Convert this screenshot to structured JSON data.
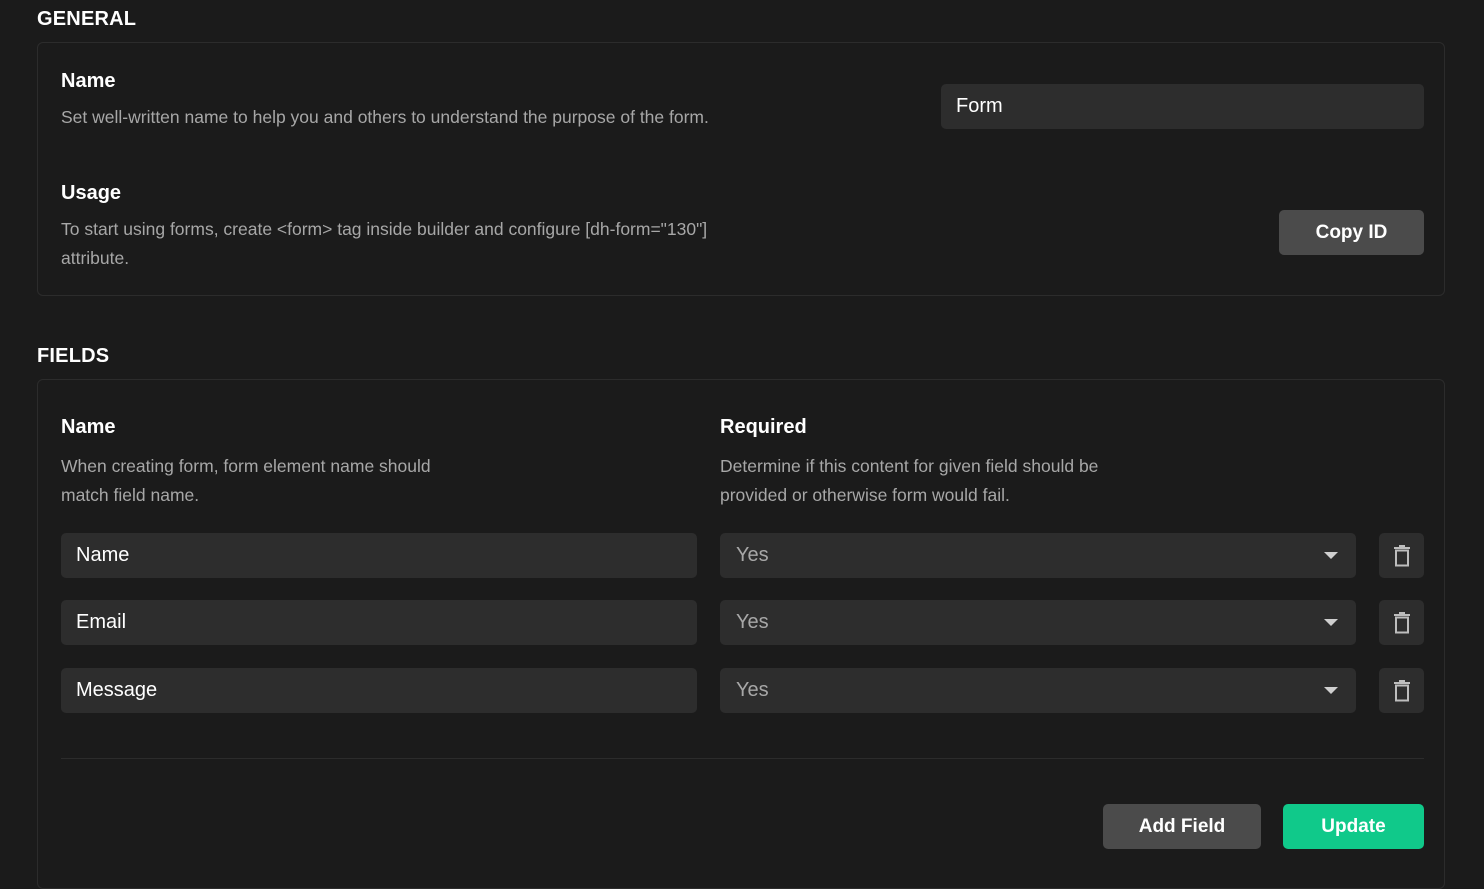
{
  "general": {
    "title": "GENERAL",
    "name_label": "Name",
    "name_description": "Set well-written name to help you and others to understand the purpose of the form.",
    "name_value": "Form",
    "usage_label": "Usage",
    "usage_description_line1": "To start using forms, create <form> tag inside builder and configure [dh-form=\"130\"]",
    "usage_description_line2": "attribute.",
    "copy_id_label": "Copy ID"
  },
  "fields": {
    "title": "FIELDS",
    "name_header": "Name",
    "name_description_line1": "When creating form, form element name should",
    "name_description_line2": "match field name.",
    "required_header": "Required",
    "required_description_line1": "Determine if this content for given field should be",
    "required_description_line2": "provided or otherwise form would fail.",
    "rows": [
      {
        "name": "Name",
        "required": "Yes"
      },
      {
        "name": "Email",
        "required": "Yes"
      },
      {
        "name": "Message",
        "required": "Yes"
      }
    ],
    "add_field_label": "Add Field",
    "update_label": "Update"
  },
  "colors": {
    "background": "#1b1b1b",
    "input_bg": "#2d2d2d",
    "accent_green": "#10c98a",
    "secondary_button": "#4b4b4b"
  },
  "icons": {
    "delete": "trash-icon",
    "dropdown": "chevron-down-icon"
  }
}
